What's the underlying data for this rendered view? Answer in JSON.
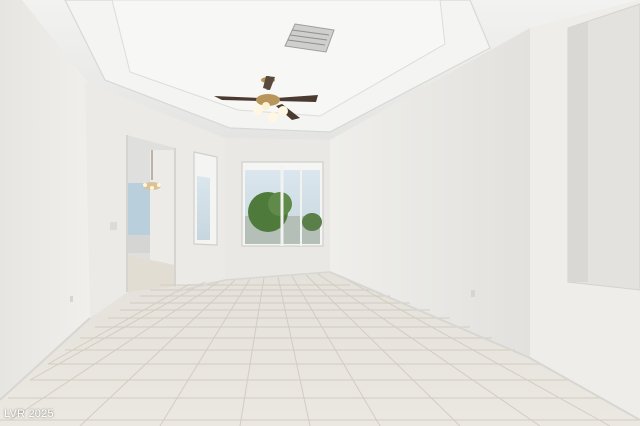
{
  "watermark": {
    "text": "LVR 2025"
  },
  "colors": {
    "wall": "#ecebe8",
    "wall_shadow": "#dcdbd8",
    "ceiling": "#eeeeec",
    "floor_tile": "#e7e3da",
    "grout": "#cfc9bd",
    "window_sky": "#cfe0ea",
    "tree": "#4e7a3c",
    "fan_brass": "#b8955a",
    "fan_blade": "#4a3a30"
  },
  "icons": [
    "ceiling-fan-icon",
    "air-vent-icon",
    "chandelier-icon"
  ]
}
